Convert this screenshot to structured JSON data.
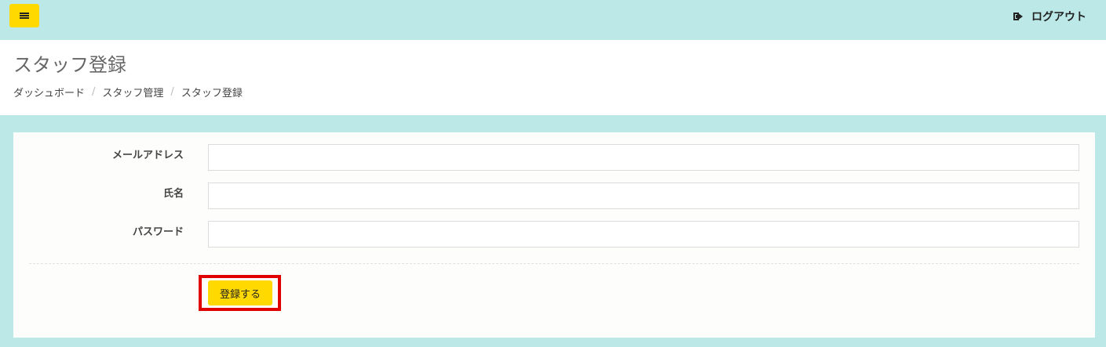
{
  "header": {
    "logout_label": "ログアウト"
  },
  "content_header": {
    "title": "スタッフ登録",
    "breadcrumb": [
      {
        "label": "ダッシュボード"
      },
      {
        "label": "スタッフ管理"
      },
      {
        "label": "スタッフ登録"
      }
    ]
  },
  "form": {
    "fields": [
      {
        "label": "メールアドレス",
        "value": "",
        "placeholder": ""
      },
      {
        "label": "氏名",
        "value": "",
        "placeholder": ""
      },
      {
        "label": "パスワード",
        "value": "",
        "placeholder": ""
      }
    ],
    "submit_label": "登録する"
  },
  "icons": {
    "menu": "hamburger-icon",
    "logout": "sign-out-icon"
  },
  "colors": {
    "background": "#bce8e8",
    "accent": "#ffd900",
    "highlight": "#e00000"
  }
}
